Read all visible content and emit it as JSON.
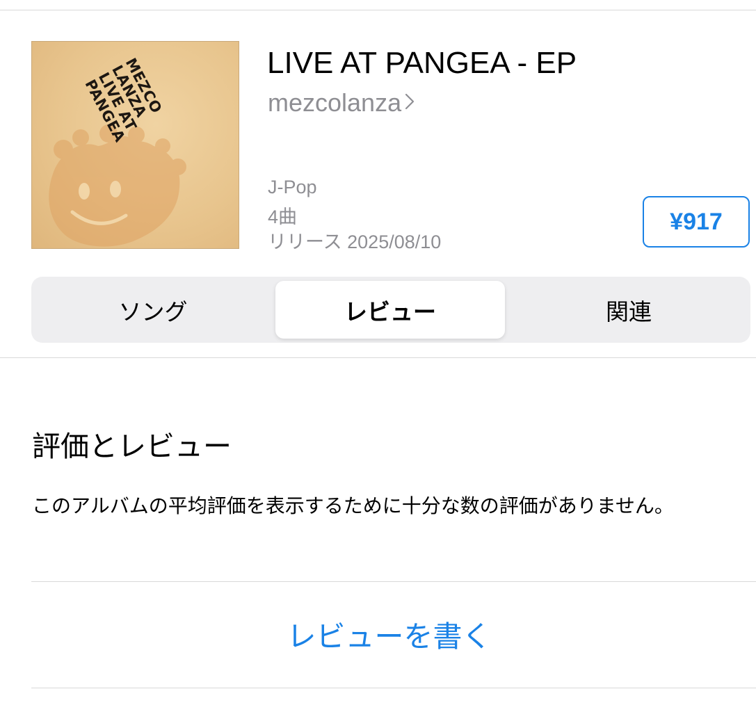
{
  "album": {
    "title": "LIVE AT PANGEA - EP",
    "artist": "mezcolanza",
    "genre": "J-Pop",
    "track_count": "4曲",
    "release": "リリース 2025/08/10",
    "price": "¥917",
    "artwork_text": [
      "MEZCO",
      "LANZA",
      "LIVE AT",
      "PANGEA"
    ]
  },
  "segments": [
    {
      "label": "ソング",
      "selected": false
    },
    {
      "label": "レビュー",
      "selected": true
    },
    {
      "label": "関連",
      "selected": false
    }
  ],
  "reviews": {
    "heading": "評価とレビュー",
    "message": "このアルバムの平均評価を表示するために十分な数の評価がありません。",
    "write_review_label": "レビューを書く"
  },
  "colors": {
    "accent": "#1a82e6",
    "secondary_text": "#8e8e93",
    "segment_background": "#eeeef0"
  },
  "icons": {
    "artist_link": "chevron-right-icon"
  }
}
